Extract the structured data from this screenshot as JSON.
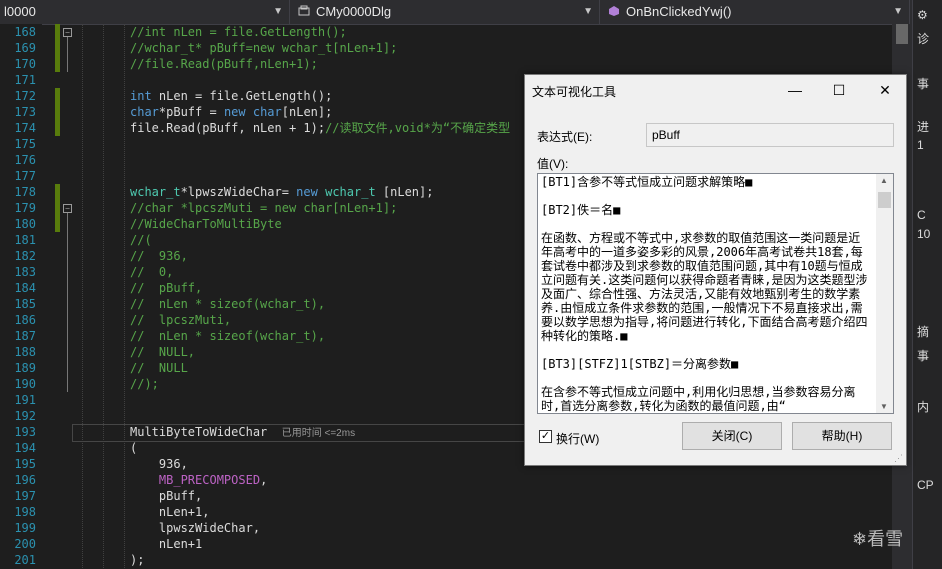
{
  "toolbar": {
    "project_dropdown": "l0000",
    "class_dropdown": "CMy0000Dlg",
    "member_dropdown": "OnBnClickedYwj()"
  },
  "editor": {
    "lines": [
      {
        "num": "168",
        "html": "<span class=\"cm\">//int nLen = file.GetLength();</span>"
      },
      {
        "num": "169",
        "html": "<span class=\"cm\">//wchar_t* pBuff=new wchar_t[nLen+1];</span>"
      },
      {
        "num": "170",
        "html": "<span class=\"cm\">//file.Read(pBuff,nLen+1);</span>"
      },
      {
        "num": "171",
        "html": ""
      },
      {
        "num": "172",
        "html": "<span class=\"kw\">int</span> nLen = file.GetLength();"
      },
      {
        "num": "173",
        "html": "<span class=\"kw\">char</span>*pBuff = <span class=\"kw\">new</span> <span class=\"kw\">char</span>[nLen];"
      },
      {
        "num": "174",
        "html": "file.Read(pBuff, nLen + 1);<span class=\"cm\">//读取文件,void*为“不确定类型</span>"
      },
      {
        "num": "175",
        "html": ""
      },
      {
        "num": "176",
        "html": ""
      },
      {
        "num": "177",
        "html": ""
      },
      {
        "num": "178",
        "html": "<span class=\"ty\">wchar_t</span>*lpwszWideChar= <span class=\"kw\">new</span> <span class=\"ty\">wchar_t</span> [nLen];"
      },
      {
        "num": "179",
        "html": "<span class=\"cm\">//char *lpcszMuti = new char[nLen+1];</span>"
      },
      {
        "num": "180",
        "html": "<span class=\"cm\">//WideCharToMultiByte</span>"
      },
      {
        "num": "181",
        "html": "<span class=\"cm\">//(</span>"
      },
      {
        "num": "182",
        "html": "<span class=\"cm\">//  936,</span>"
      },
      {
        "num": "183",
        "html": "<span class=\"cm\">//  0,</span>"
      },
      {
        "num": "184",
        "html": "<span class=\"cm\">//  pBuff,</span>"
      },
      {
        "num": "185",
        "html": "<span class=\"cm\">//  nLen * sizeof(wchar_t),</span>"
      },
      {
        "num": "186",
        "html": "<span class=\"cm\">//  lpcszMuti,</span>"
      },
      {
        "num": "187",
        "html": "<span class=\"cm\">//  nLen * sizeof(wchar_t),</span>"
      },
      {
        "num": "188",
        "html": "<span class=\"cm\">//  NULL,</span>"
      },
      {
        "num": "189",
        "html": "<span class=\"cm\">//  NULL</span>"
      },
      {
        "num": "190",
        "html": "<span class=\"cm\">//);</span>"
      },
      {
        "num": "191",
        "html": ""
      },
      {
        "num": "192",
        "html": ""
      },
      {
        "num": "193",
        "html": "MultiByteToWideChar  <span class=\"hint\">已用时间 &lt;=2ms</span>"
      },
      {
        "num": "194",
        "html": "("
      },
      {
        "num": "195",
        "html": "    936,"
      },
      {
        "num": "196",
        "html": "    <span class=\"mac\">MB_PRECOMPOSED</span>,"
      },
      {
        "num": "197",
        "html": "    pBuff,"
      },
      {
        "num": "198",
        "html": "    nLen+1,"
      },
      {
        "num": "199",
        "html": "    lpwszWideChar,"
      },
      {
        "num": "200",
        "html": "    nLen+1"
      },
      {
        "num": "201",
        "html": ");"
      }
    ]
  },
  "right_panel": {
    "items": [
      "诊",
      "事",
      "进",
      "1",
      "C",
      "10",
      "摘",
      "事",
      "内",
      "CP"
    ]
  },
  "dialog": {
    "title": "文本可视化工具",
    "minimize": "—",
    "maximize": "☐",
    "close": "✕",
    "expression_label": "表达式(E):",
    "expression_value": "pBuff",
    "value_label": "值(V):",
    "value_text": "[BT1]含参不等式恒成立问题求解策略■\n\n[BT2]佚＝名■\n\n在函数、方程或不等式中,求参数的取值范围这一类问题是近年高考中的一道多姿多彩的风景,2006年高考试卷共18套,每套试卷中都涉及到求参数的取值范围问题,其中有10题与恒成立问题有关.这类问题何以获得命题者青睐,是因为这类题型涉及面广、综合性强、方法灵活,又能有效地甄别考生的数学素养.由恒成立条件求参数的范围,一般情况下不易直接求出,需要以数学思想为指导,将问题进行转化,下面结合高考题介绍四种转化的策略.■\n\n[BT3][STFZ]1[STBZ]＝分离参数■\n\n在含参不等式恒成立问题中,利用化归思想,当参数容易分离时,首选分离参数,转化为函数的最值问题,由“",
    "wrap_label": "换行(W)",
    "wrap_checked": "✓",
    "close_button": "关闭(C)",
    "help_button": "帮助(H)"
  },
  "watermark": "❄看雪"
}
